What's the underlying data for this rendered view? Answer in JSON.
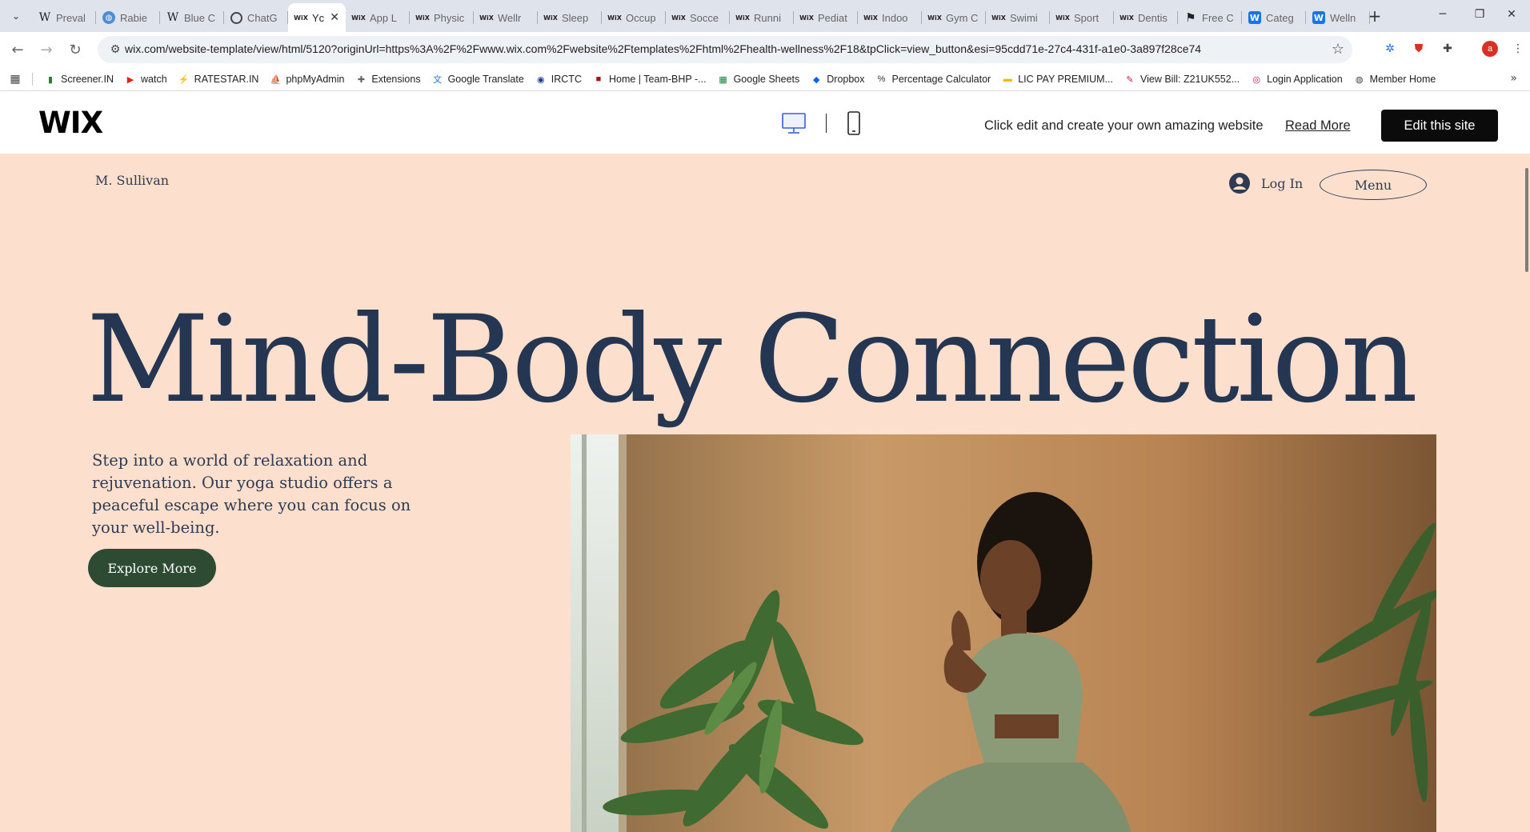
{
  "browser": {
    "tabs": [
      {
        "favicon": "wikipedia-icon",
        "glyph": "W",
        "cls": "wiki",
        "title": "Preval"
      },
      {
        "favicon": "un-icon",
        "glyph": "◍",
        "cls": "un",
        "title": "Rabie"
      },
      {
        "favicon": "wikipedia-icon",
        "glyph": "W",
        "cls": "wiki",
        "title": "Blue C"
      },
      {
        "favicon": "chatgpt-icon",
        "glyph": "",
        "cls": "gpt",
        "title": "ChatG"
      },
      {
        "favicon": "wix-icon",
        "glyph": "WiX",
        "cls": "",
        "title": "Yc",
        "active": true
      },
      {
        "favicon": "wix-icon",
        "glyph": "WiX",
        "cls": "",
        "title": "App L"
      },
      {
        "favicon": "wix-icon",
        "glyph": "WiX",
        "cls": "",
        "title": "Physic"
      },
      {
        "favicon": "wix-icon",
        "glyph": "WiX",
        "cls": "",
        "title": "Wellr"
      },
      {
        "favicon": "wix-icon",
        "glyph": "WiX",
        "cls": "",
        "title": "Sleep"
      },
      {
        "favicon": "wix-icon",
        "glyph": "WiX",
        "cls": "",
        "title": "Occup"
      },
      {
        "favicon": "wix-icon",
        "glyph": "WiX",
        "cls": "",
        "title": "Socce"
      },
      {
        "favicon": "wix-icon",
        "glyph": "WiX",
        "cls": "",
        "title": "Runni"
      },
      {
        "favicon": "wix-icon",
        "glyph": "WiX",
        "cls": "",
        "title": "Pediat"
      },
      {
        "favicon": "wix-icon",
        "glyph": "WiX",
        "cls": "",
        "title": "Indoo"
      },
      {
        "favicon": "wix-icon",
        "glyph": "WiX",
        "cls": "",
        "title": "Gym C"
      },
      {
        "favicon": "wix-icon",
        "glyph": "WiX",
        "cls": "",
        "title": "Swimi"
      },
      {
        "favicon": "wix-icon",
        "glyph": "WiX",
        "cls": "",
        "title": "Sport"
      },
      {
        "favicon": "wix-icon",
        "glyph": "WiX",
        "cls": "",
        "title": "Dentis"
      },
      {
        "favicon": "framer-icon",
        "glyph": "⚑",
        "cls": "fr",
        "title": "Free C"
      },
      {
        "favicon": "wix-blue-icon",
        "glyph": "W",
        "cls": "blue",
        "title": "Categ"
      },
      {
        "favicon": "wix-blue-icon",
        "glyph": "W",
        "cls": "blue",
        "title": "Welln"
      }
    ],
    "tab_close_glyph": "✕",
    "new_tab_glyph": "+",
    "window_controls": {
      "minimize": "─",
      "restore": "❐",
      "close": "✕"
    },
    "url": "wix.com/website-template/view/html/5120?originUrl=https%3A%2F%2Fwww.wix.com%2Fwebsite%2Ftemplates%2Fhtml%2Fhealth-wellness%2F18&tpClick=view_button&esi=95cdd71e-27c4-431f-a1e0-3a897f28ce74",
    "profile_initial": "a",
    "bookmarks": [
      {
        "label": "Screener.IN",
        "icon": "screener-icon",
        "glyph": "▮",
        "color": "#2e7d32"
      },
      {
        "label": "watch",
        "icon": "youtube-icon",
        "glyph": "▶",
        "color": "#e62117"
      },
      {
        "label": "RATESTAR.IN",
        "icon": "ratestar-icon",
        "glyph": "⚡",
        "color": "#555555"
      },
      {
        "label": "phpMyAdmin",
        "icon": "phpmyadmin-icon",
        "glyph": "⛵",
        "color": "#f29111"
      },
      {
        "label": "Extensions",
        "icon": "puzzle-icon",
        "glyph": "✚",
        "color": "#5f6368"
      },
      {
        "label": "Google Translate",
        "icon": "translate-icon",
        "glyph": "文",
        "color": "#1a73e8"
      },
      {
        "label": "IRCTC",
        "icon": "irctc-icon",
        "glyph": "◉",
        "color": "#1a3e8c"
      },
      {
        "label": "Home | Team-BHP -...",
        "icon": "teambhp-icon",
        "glyph": "■",
        "color": "#a31515"
      },
      {
        "label": "Google Sheets",
        "icon": "sheets-icon",
        "glyph": "▦",
        "color": "#188038"
      },
      {
        "label": "Dropbox",
        "icon": "dropbox-icon",
        "glyph": "◆",
        "color": "#0061fe"
      },
      {
        "label": "Percentage Calculator",
        "icon": "percent-icon",
        "glyph": "%",
        "color": "#333333"
      },
      {
        "label": "LIC PAY PREMIUM...",
        "icon": "lic-icon",
        "glyph": "▬",
        "color": "#f2b705"
      },
      {
        "label": "View Bill: Z21UK552...",
        "icon": "bill-icon",
        "glyph": "✎",
        "color": "#c2185b"
      },
      {
        "label": "Login Application",
        "icon": "login-app-icon",
        "glyph": "◎",
        "color": "#c2185b"
      },
      {
        "label": "Member Home",
        "icon": "globe-icon",
        "glyph": "◍",
        "color": "#444444"
      }
    ]
  },
  "wix_bar": {
    "logo": "WIX",
    "promo_text": "Click edit and create your own amazing website",
    "read_more": "Read More",
    "edit_button": "Edit this site"
  },
  "site": {
    "owner": "M. Sullivan",
    "login": "Log In",
    "menu": "Menu",
    "hero_title": "Mind-Body Connection",
    "hero_description": "Step into a world of relaxation and rejuvenation. Our yoga studio offers a peaceful escape where you can focus on your well-being.",
    "cta": "Explore More"
  },
  "colors": {
    "site_bg": "#fce0cd",
    "heading": "#243651",
    "cta_bg": "#2d4a33"
  }
}
